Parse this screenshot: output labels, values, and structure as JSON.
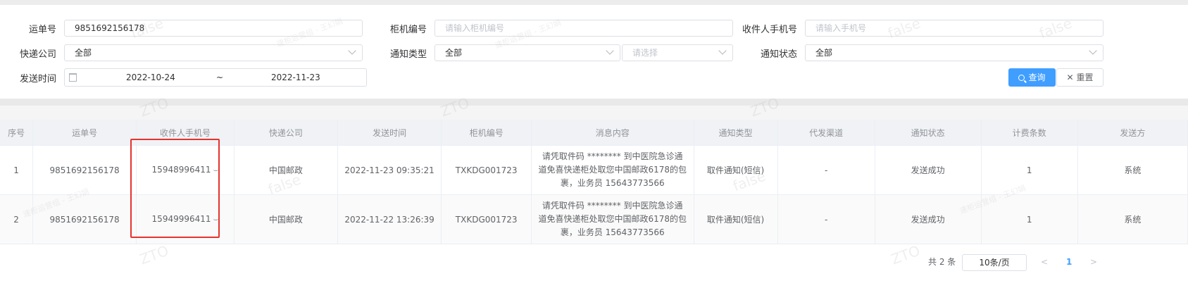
{
  "filters": {
    "waybill_label": "运单号",
    "waybill_value": "9851692156178",
    "cabinet_label": "柜机编号",
    "cabinet_placeholder": "请输入柜机编号",
    "phone_label": "收件人手机号",
    "phone_placeholder": "请输入手机号",
    "courier_label": "快递公司",
    "courier_value": "全部",
    "notice_type_label": "通知类型",
    "notice_type_value": "全部",
    "notice_sub_placeholder": "请选择",
    "notice_status_label": "通知状态",
    "notice_status_value": "全部",
    "send_time_label": "发送时间",
    "date_start": "2022-10-24",
    "date_sep": "~",
    "date_end": "2022-11-23",
    "query_button": "查询",
    "reset_button": "重置"
  },
  "table": {
    "columns": [
      "序号",
      "运单号",
      "收件人手机号",
      "快递公司",
      "发送时间",
      "柜机编号",
      "消息内容",
      "通知类型",
      "代发渠道",
      "通知状态",
      "计费条数",
      "发送方"
    ],
    "rows": [
      {
        "index": "1",
        "waybill": "9851692156178",
        "phone": "15948996411",
        "courier": "中国邮政",
        "send_time": "2022-11-23 09:35:21",
        "cabinet": "TXKDG001723",
        "message": "请凭取件码 ******** 到中医院急诊通道免喜快递柜处取您中国邮政6178的包裹，业务员 15643773566",
        "notice_type": "取件通知(短信)",
        "channel": "-",
        "status": "发送成功",
        "billing": "1",
        "sender": "系统"
      },
      {
        "index": "2",
        "waybill": "9851692156178",
        "phone": "15949996411",
        "courier": "中国邮政",
        "send_time": "2022-11-22 13:26:39",
        "cabinet": "TXKDG001723",
        "message": "请凭取件码 ******** 到中医院急诊通道免喜快递柜处取您中国邮政6178的包裹，业务员 15643773566",
        "notice_type": "取件通知(短信)",
        "channel": "-",
        "status": "发送成功",
        "billing": "1",
        "sender": "系统"
      }
    ]
  },
  "pagination": {
    "total": "共 2 条",
    "page_size": "10条/页",
    "prev": "<",
    "current": "1",
    "next": ">"
  },
  "watermarks": {
    "logo": "ZTO",
    "flag": "false",
    "operator": "速柜运营组 - 王幻娟"
  },
  "colors": {
    "primary": "#409eff",
    "highlight": "#e5332e"
  }
}
